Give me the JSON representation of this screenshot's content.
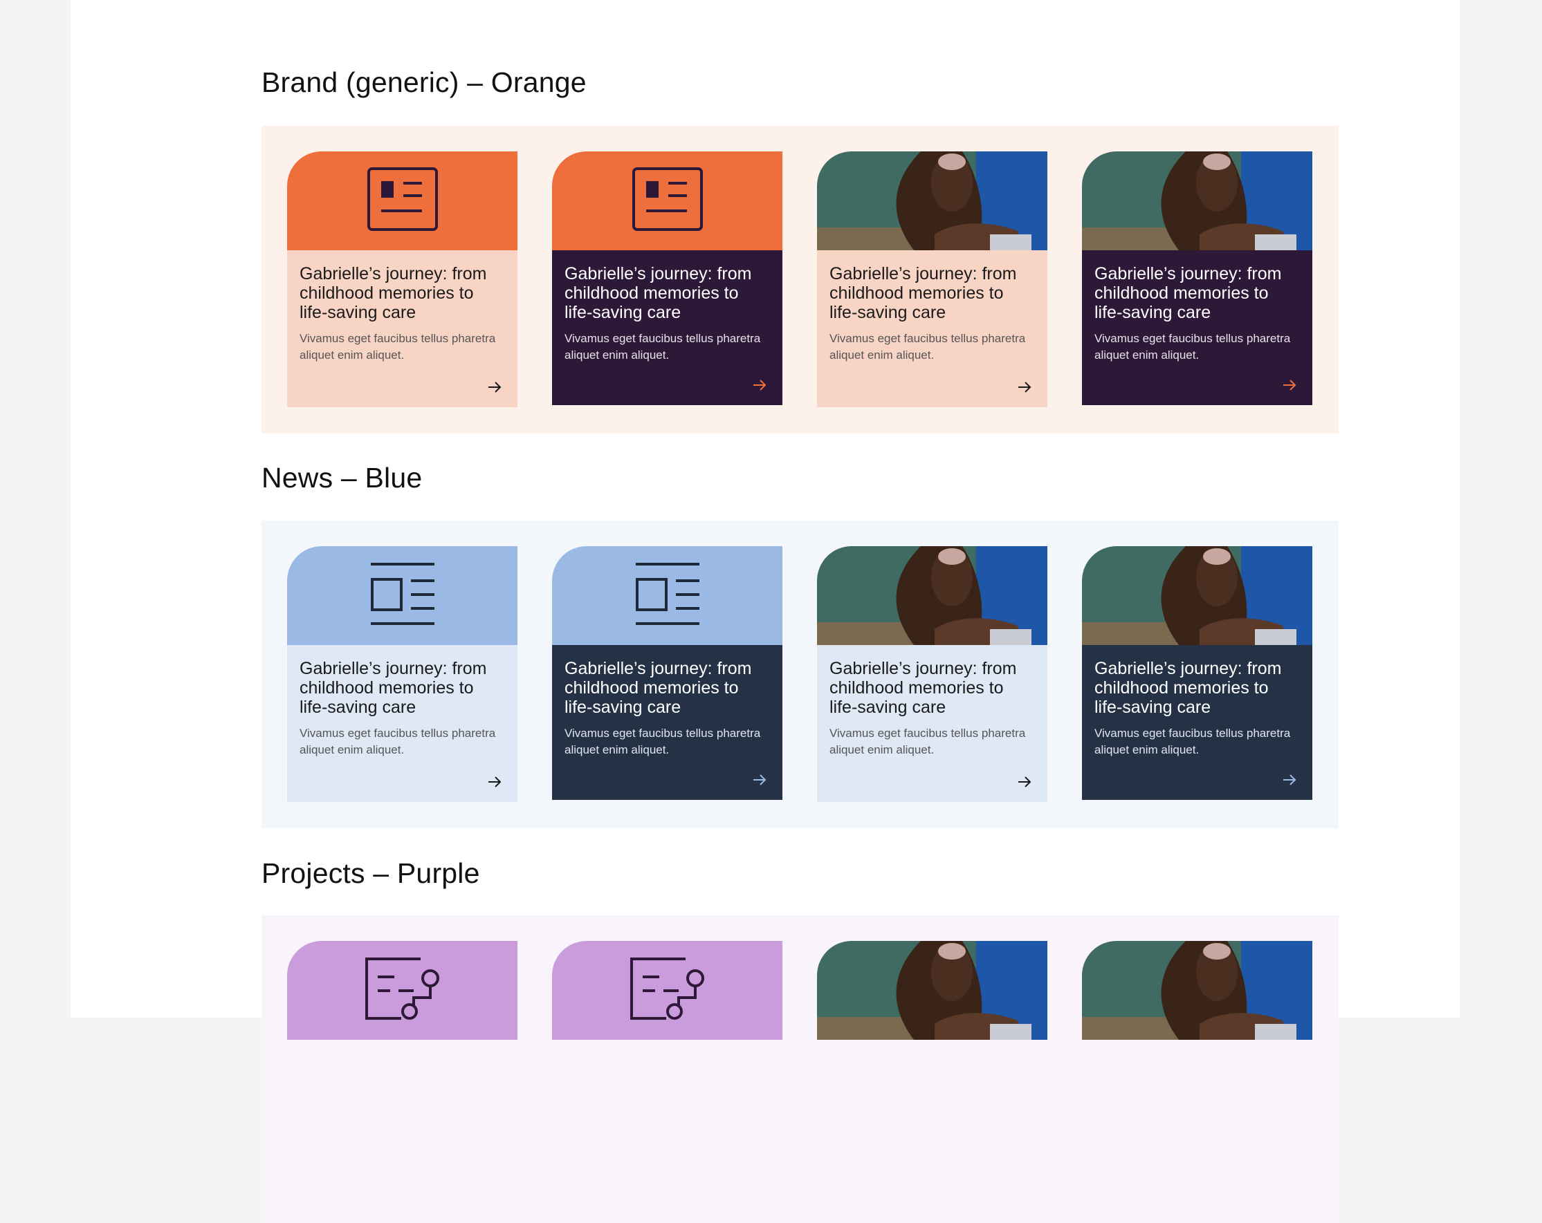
{
  "sections": [
    {
      "title": "Brand (generic) –  Orange",
      "colors": {
        "panel": "#fdf1ec",
        "top": "#ee6f3b",
        "light_body": "#f8d4c5",
        "dark_body": "#2e1838",
        "dark_arrow": "#ee6f3b",
        "icon": "#2e1838"
      },
      "icon": "id-card-icon"
    },
    {
      "title": "News – Blue",
      "colors": {
        "panel": "#f3f7fc",
        "top": "#9bb9e5",
        "light_body": "#dfe9f6",
        "dark_body": "#253246",
        "dark_arrow": "#9bb9e5",
        "icon": "#1e2836"
      },
      "icon": "newspaper-icon"
    },
    {
      "title": "Projects – Purple",
      "colors": {
        "panel": "#f9f3fb",
        "top": "#cb9cdc",
        "light_body": "#f0e1f5",
        "dark_body": "#2e1838",
        "dark_arrow": "#cb9cdc",
        "icon": "#2e1838"
      },
      "icon": "project-board-icon"
    }
  ],
  "card": {
    "title": "Gabrielle’s journey: from childhood memories to life-saving care",
    "description": "Vivamus eget faucibus tellus pharetra aliquet enim aliquet."
  }
}
